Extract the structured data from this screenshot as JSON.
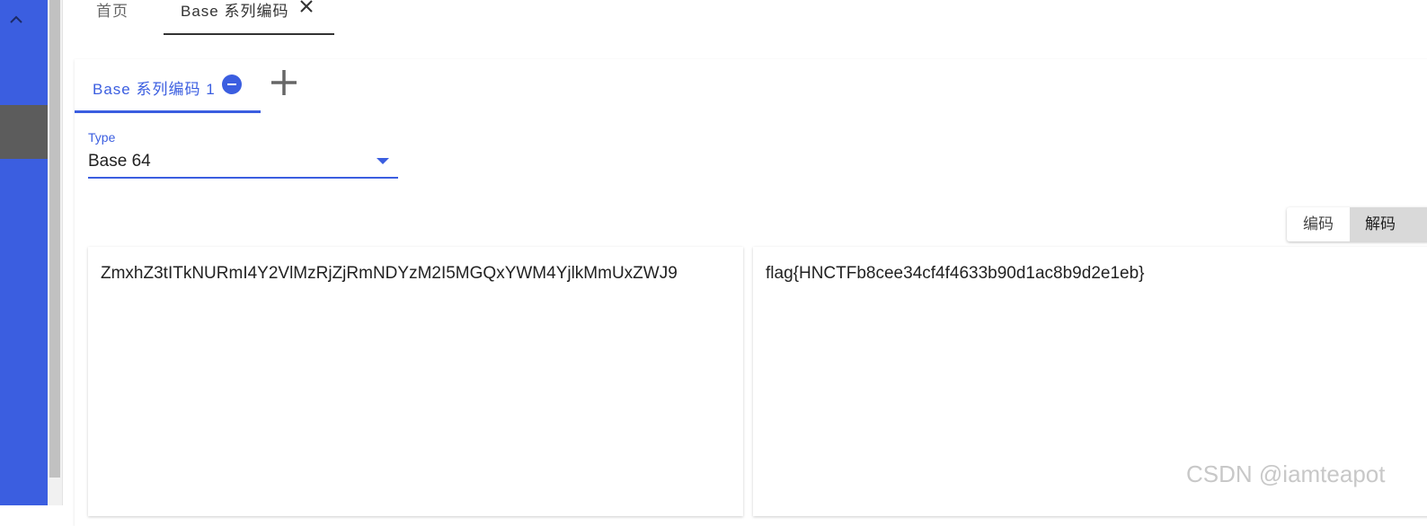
{
  "sidebar": {
    "collapse_icon": "chevron-up-icon",
    "accent_color": "#3b5ee0"
  },
  "top_tabs": [
    {
      "label": "首页"
    },
    {
      "label": "Base 系列编码",
      "close_icon": "close-icon"
    }
  ],
  "sub_tabs": [
    {
      "label": "Base 系列编码 1",
      "remove_icon": "minus-circle-icon"
    }
  ],
  "add_tab_icon": "plus-icon",
  "type_select": {
    "label": "Type",
    "value": "Base 64"
  },
  "mode_toggle": {
    "encode_label": "编码",
    "decode_label": "解码",
    "selected": "解码"
  },
  "input_text": "ZmxhZ3tITkNURmI4Y2VlMzRjZjRmNDYzM2I5MGQxYWM4YjlkMmUxZWJ9",
  "output_text": "flag{HNCTFb8cee34cf4f4633b90d1ac8b9d2e1eb}",
  "watermark": "CSDN @iamteapot"
}
